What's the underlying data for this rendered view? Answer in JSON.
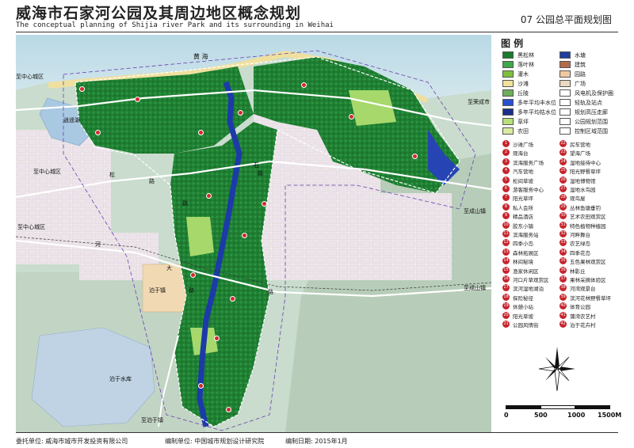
{
  "header": {
    "title_cn": "威海市石家河公园及其周边地区概念规划",
    "title_en": "The conceptual planning of Shijia river Park  and its surrounding in  Weihai",
    "sheet": "07  公园总平面规划图"
  },
  "map": {
    "labels": {
      "sea": "黄  海",
      "lake": "逍遥湖",
      "reservoir": "泊于水库",
      "town": "泊于镇",
      "town_road": "路",
      "rd_zhizhong_top": "至中心城区",
      "rd_zhizhong_mid1": "至中心城区",
      "rd_zhizhong_mid2": "至中心城区",
      "rd_rongcheng": "至荣成市",
      "rd_chengshan1": "至成山镇",
      "rd_chengshan2": "至成山镇",
      "rd_zhizhong_bottom": "至泊于镇",
      "song": "松",
      "lu1": "路",
      "lu2": "路",
      "lu3": "路",
      "lu4": "路",
      "shi": "石",
      "da": "大",
      "he": "河"
    }
  },
  "legend": {
    "title": "图  例",
    "symbols": [
      {
        "label": "黑松林",
        "color": "#1b7a2e"
      },
      {
        "label": "水塘",
        "color": "#1f3f9e"
      },
      {
        "label": "落叶林",
        "color": "#3da84a"
      },
      {
        "label": "建筑",
        "color": "#b46b4a"
      },
      {
        "label": "灌木",
        "color": "#7fbf3f"
      },
      {
        "label": "园路",
        "color": "#f0c8a0"
      },
      {
        "label": "沙滩",
        "color": "#f2e29a"
      },
      {
        "label": "广场",
        "color": "#e9d9c0"
      },
      {
        "label": "丘陵",
        "color": "#6fae5a"
      },
      {
        "label": "风电机及保护圈",
        "color": "#ffffff"
      },
      {
        "label": "多年平均丰水位",
        "color": "#2a4fd0"
      },
      {
        "label": "轻轨及站点",
        "color": "#ffffff"
      },
      {
        "label": "多年平均枯水位",
        "color": "#1a2f8a"
      },
      {
        "label": "规划高压走廊",
        "color": "#ffffff"
      },
      {
        "label": "草坪",
        "color": "#b7e07a"
      },
      {
        "label": "公园规划范围",
        "color": "#ffffff"
      },
      {
        "label": "农田",
        "color": "#d7ec9f"
      },
      {
        "label": "控制区域范围",
        "color": "#ffffff"
      }
    ],
    "places_left": [
      "沙滩广场",
      "观海台",
      "滨海服务广场",
      "汽车营地",
      "松间草坡",
      "游客服务中心",
      "阳光草坪",
      "私人会所",
      "精品酒店",
      "胶东小镇",
      "滨海服务站",
      "四季小岛",
      "森林拓展区",
      "林间秘境",
      "渔家休闲区",
      "河口片草观赏区",
      "滨河湿地湖泊",
      "探险秘径",
      "休憩小站",
      "阳光草坡",
      "公园风情街"
    ],
    "nums_left": [
      "1",
      "2",
      "3",
      "4",
      "5",
      "6",
      "7",
      "8",
      "9",
      "10",
      "11",
      "12",
      "13",
      "14",
      "15",
      "16",
      "17",
      "18",
      "19",
      "20",
      "21"
    ],
    "places_right": [
      "房车营地",
      "望海广场",
      "湿地接待中心",
      "阳光野餐草坪",
      "湿地博物馆",
      "湿地水鸟园",
      "观鸟屋",
      "丛林鱼塘垂钓",
      "艺术农田观赏区",
      "特色植物种植园",
      "河畔舞台",
      "农艺绿岛",
      "四季花岛",
      "五色果林观赏区",
      "林影丘",
      "果林采摘体验区",
      "河湾观景台",
      "滨河花林野餐草坪",
      "体育公园",
      "蒲湾农艺村",
      "泊于花卉村"
    ],
    "nums_right": [
      "22",
      "23",
      "24",
      "25",
      "26",
      "27",
      "28",
      "29",
      "30",
      "31",
      "32",
      "33",
      "34",
      "35",
      "36",
      "37",
      "38",
      "39",
      "40",
      "41",
      "42"
    ],
    "scale": {
      "s0": "0",
      "s1": "500",
      "s2": "1000",
      "s3": "1500M"
    }
  },
  "footer": {
    "client": "委托单位:  威海市城市开发投资有限公司",
    "designer": "编制单位:  中国城市规划设计研究院",
    "date": "编制日期:  2015年1月"
  }
}
